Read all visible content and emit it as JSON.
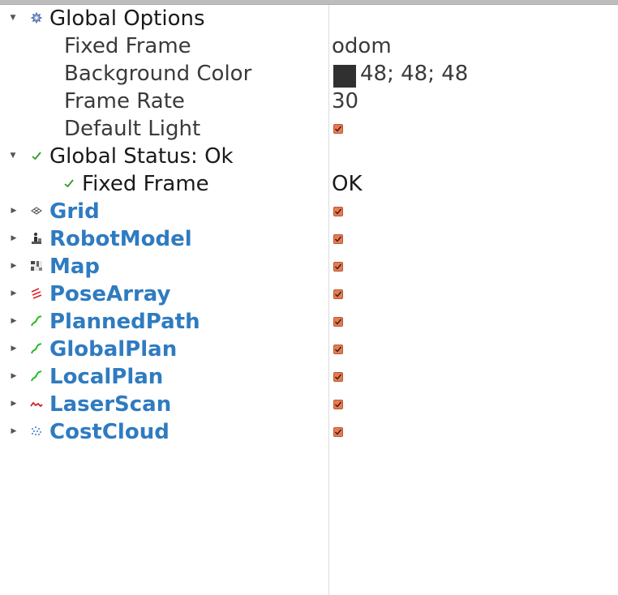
{
  "tree": {
    "global_options": {
      "label": "Global Options",
      "fixed_frame": {
        "label": "Fixed Frame",
        "value": "odom"
      },
      "background_color": {
        "label": "Background Color",
        "value": "48; 48; 48",
        "swatch": "#303030"
      },
      "frame_rate": {
        "label": "Frame Rate",
        "value": "30"
      },
      "default_light": {
        "label": "Default Light",
        "checked": true
      }
    },
    "global_status": {
      "label": "Global Status: Ok",
      "fixed_frame": {
        "label": "Fixed Frame",
        "value": "OK"
      }
    },
    "displays": [
      {
        "label": "Grid",
        "icon": "grid-icon",
        "checked": true
      },
      {
        "label": "RobotModel",
        "icon": "robot-model-icon",
        "checked": true
      },
      {
        "label": "Map",
        "icon": "map-icon",
        "checked": true
      },
      {
        "label": "PoseArray",
        "icon": "pose-array-icon",
        "checked": true
      },
      {
        "label": "PlannedPath",
        "icon": "path-icon",
        "checked": true
      },
      {
        "label": "GlobalPlan",
        "icon": "path-icon",
        "checked": true
      },
      {
        "label": "LocalPlan",
        "icon": "path-icon",
        "checked": true
      },
      {
        "label": "LaserScan",
        "icon": "laser-scan-icon",
        "checked": true
      },
      {
        "label": "CostCloud",
        "icon": "point-cloud-icon",
        "checked": true
      }
    ]
  },
  "colors": {
    "display_label": "#2f7bc0",
    "checkbox": "#e87a53",
    "status_ok": "#2a9a2a",
    "path_green": "#22bb22",
    "laser_red": "#cc2222",
    "pose_red": "#dd2222"
  }
}
